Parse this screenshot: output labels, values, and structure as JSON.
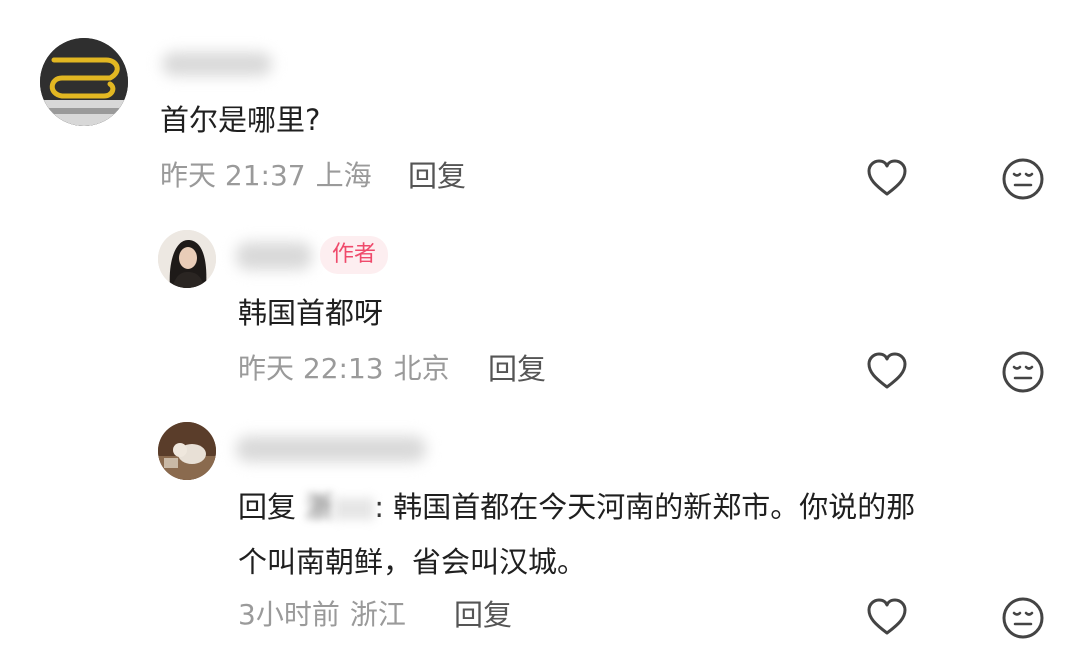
{
  "comments": [
    {
      "text": "首尔是哪里?",
      "time": "昨天 21:37",
      "location": "上海",
      "reply_label": "回复",
      "avatar": "number-5-avatar"
    },
    {
      "author_badge": "作者",
      "text": "韩国首都呀",
      "time": "昨天 22:13",
      "location": "北京",
      "reply_label": "回复",
      "avatar": "woman-photo-avatar"
    },
    {
      "reply_prefix": "回复",
      "reply_to_name": "浙",
      "text_line1": ": 韩国首都在今天河南的新郑市。你说的那",
      "text_line2": "个叫南朝鲜，省会叫汉城。",
      "time": "3小时前",
      "location": "浙江",
      "reply_label": "回复",
      "avatar": "cat-photo-avatar"
    }
  ],
  "icons": {
    "like": "heart-outline-icon",
    "dislike": "neutral-face-icon"
  },
  "colors": {
    "badge_text": "#ef4a6b",
    "badge_bg": "#fdeef0",
    "meta_text": "#9a9a9a"
  }
}
